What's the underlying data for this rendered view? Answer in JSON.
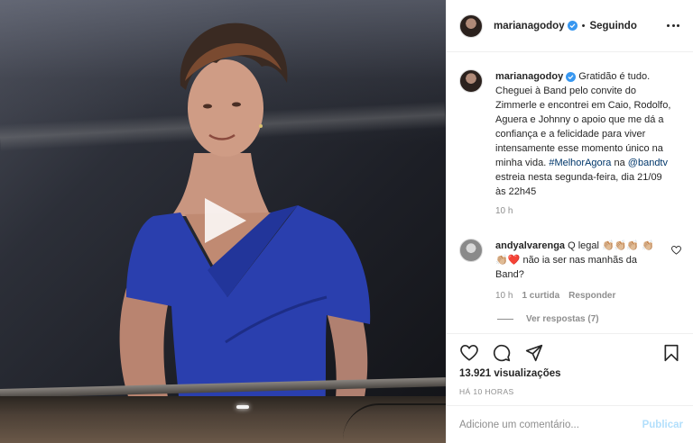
{
  "post": {
    "username": "marianagodoy",
    "follow_status": "Seguindo",
    "header_dot": "•",
    "caption_text": "Gratidão é tudo. Cheguei à Band pelo convite do Zimmerle e encontrei em Caio, Rodolfo, Aguera e Johnny o apoio que me dá a confiança e a felicidade para viver intensamente esse momento único na minha vida.",
    "hashtag": "#MelhorAgora",
    "caption_mid": "na",
    "mention": "@bandtv",
    "caption_end": "estreia nesta segunda-feira, dia 21/09 às 22h45",
    "caption_time": "10 h",
    "likes": "13.921 visualizações",
    "timestamp": "HÁ 10 HORAS"
  },
  "comment": {
    "username": "andyalvarenga",
    "text": "Q legal 👏🏼👏🏼👏🏼 👏🏼👏🏼❤️ não ia ser nas manhãs da Band?",
    "time": "10 h",
    "likes": "1 curtida",
    "reply_label": "Responder",
    "view_replies": "Ver respostas (7)"
  },
  "add_comment": {
    "placeholder": "Adicione um comentário...",
    "publish_label": "Publicar"
  },
  "colors": {
    "accent": "#3897f0",
    "link": "#00376b",
    "muted": "#8e8e8e",
    "publish_disabled": "#b2dffc",
    "dress": "#2a3fae"
  },
  "icons": [
    "more-icon",
    "verified-icon",
    "play-icon",
    "heart-icon",
    "comment-icon",
    "share-icon",
    "save-icon"
  ]
}
